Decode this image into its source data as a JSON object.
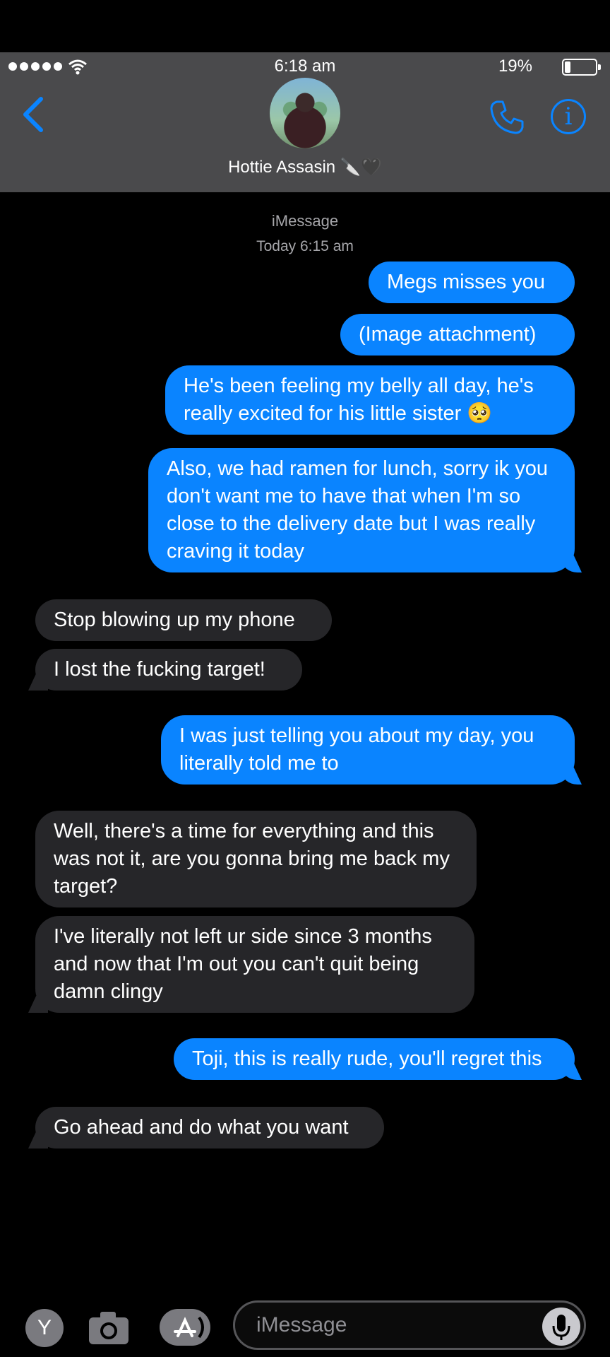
{
  "status_bar": {
    "time": "6:18 am",
    "battery": "19%",
    "signal_dots": 5
  },
  "header": {
    "contact_name": "Hottie Assasin",
    "contact_emoji": "🔪🖤"
  },
  "thread": {
    "service": "iMessage",
    "timestamp": "Today 6:15 am",
    "messages": [
      {
        "from": "me",
        "text": "Megs misses you"
      },
      {
        "from": "me",
        "text": "(Image attachment)"
      },
      {
        "from": "me",
        "text": "He's been feeling my belly all day, he's really excited for his little sister 🥺"
      },
      {
        "from": "me",
        "text": "Also, we had ramen for lunch, sorry ik you don't want me to have that when I'm so close to the delivery date but I was really craving it today"
      },
      {
        "from": "them",
        "text": "Stop blowing up my phone"
      },
      {
        "from": "them",
        "text": "I lost the fucking target!"
      },
      {
        "from": "me",
        "text": "I was just telling you about my day, you literally told me to"
      },
      {
        "from": "them",
        "text": "Well, there's a time for everything and this was not it, are you gonna bring me back my target?"
      },
      {
        "from": "them",
        "text": "I've literally not left ur side since 3 months and now that I'm out you can't quit being damn clingy"
      },
      {
        "from": "me",
        "text": "Toji, this is really rude, you'll regret this"
      },
      {
        "from": "them",
        "text": "Go ahead and do what you want"
      }
    ]
  },
  "composer": {
    "y_button": "Y",
    "placeholder": "iMessage"
  },
  "colors": {
    "sent": "#0a84ff",
    "received": "#262629",
    "header": "#4a4a4c"
  }
}
